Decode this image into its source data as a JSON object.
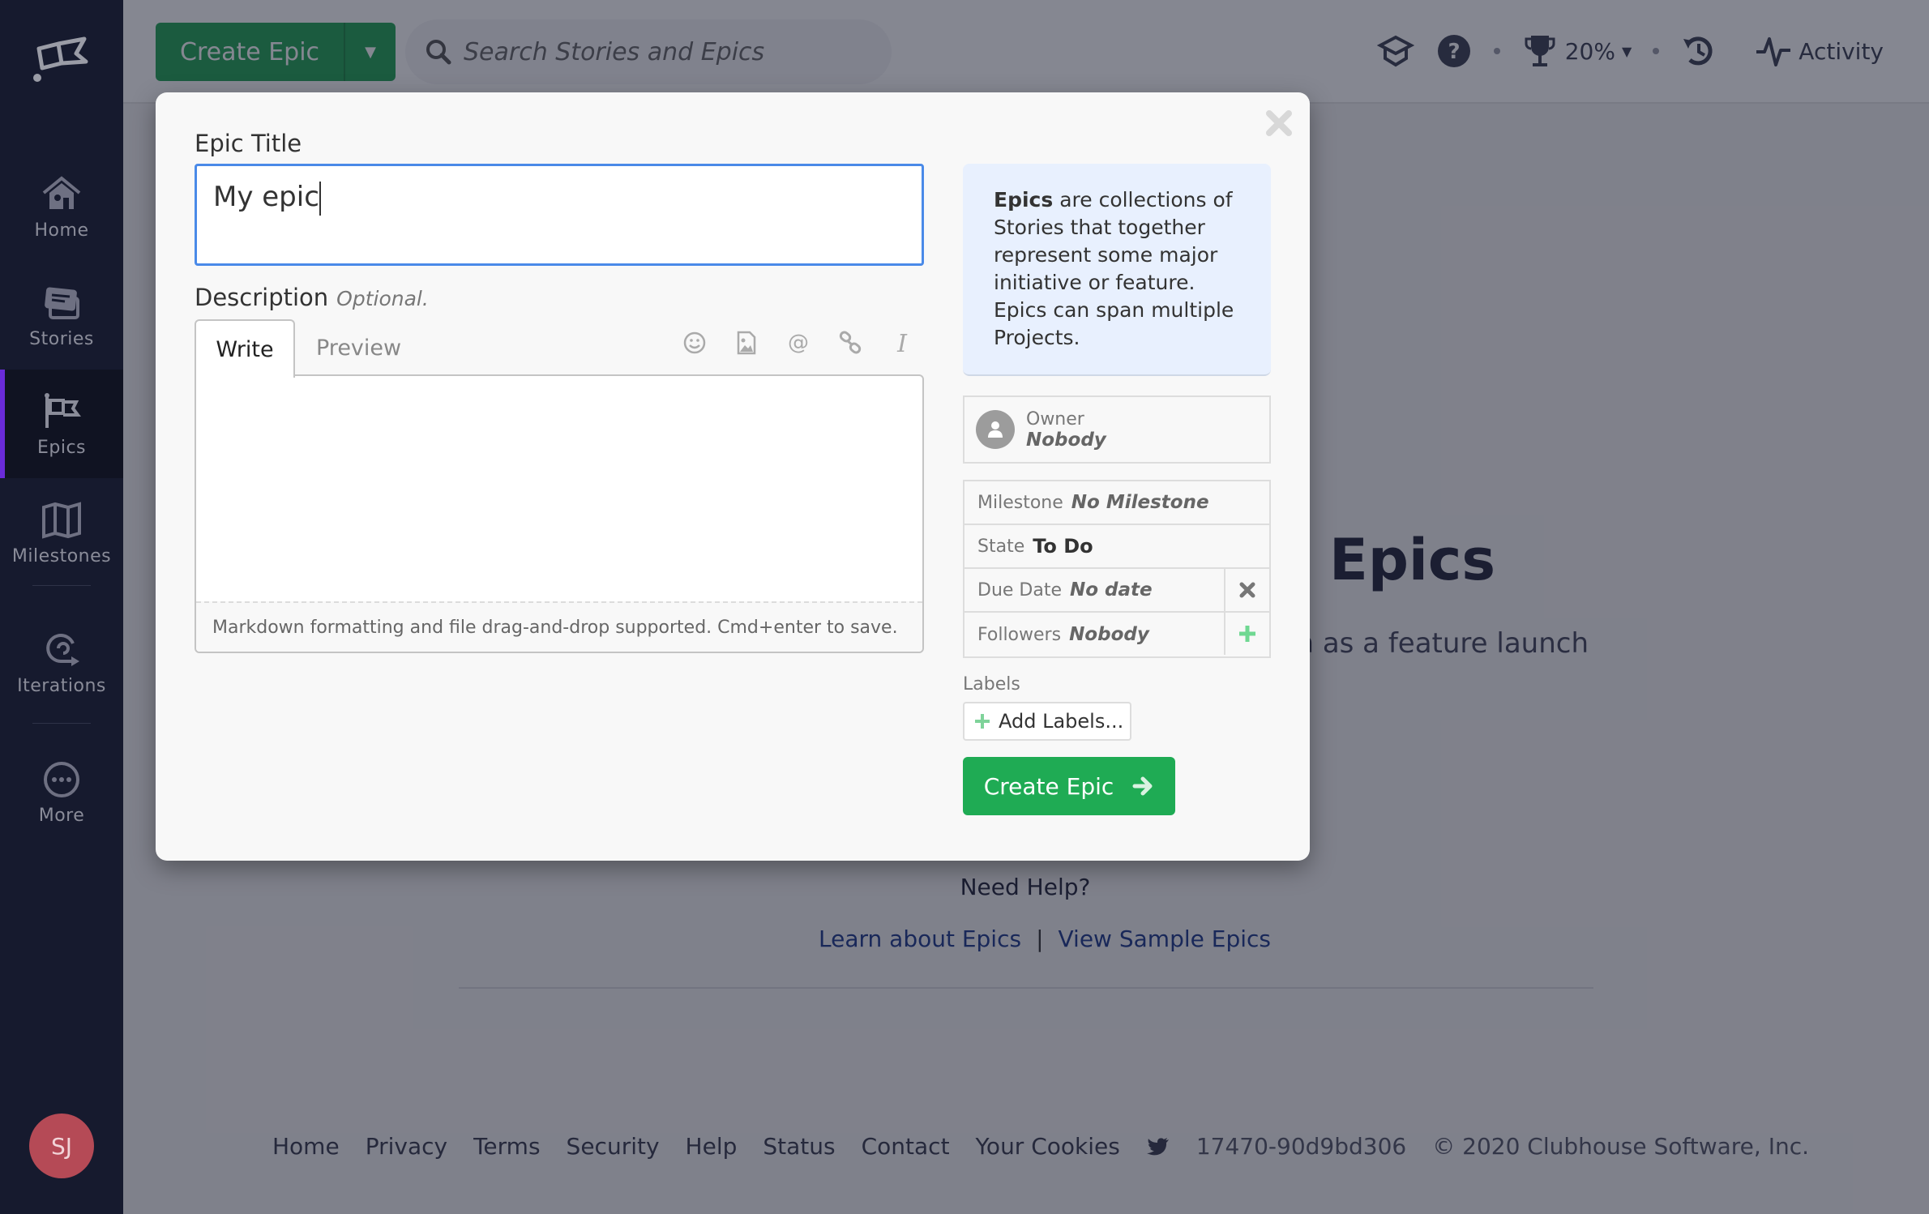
{
  "sidebar": {
    "items": [
      {
        "label": "Home",
        "icon": "home-icon"
      },
      {
        "label": "Stories",
        "icon": "stories-icon"
      },
      {
        "label": "Epics",
        "icon": "epics-flag-icon",
        "active": true
      },
      {
        "label": "Milestones",
        "icon": "map-icon"
      },
      {
        "label": "Iterations",
        "icon": "iterations-icon"
      },
      {
        "label": "More",
        "icon": "more-dots-icon"
      }
    ],
    "avatar_initials": "SJ"
  },
  "topbar": {
    "create_label": "Create Epic",
    "search_placeholder": "Search Stories and Epics",
    "progress_label": "20%",
    "activity_label": "Activity"
  },
  "page": {
    "title": "Epics",
    "subtitle_fragment": "ch as a feature launch",
    "need_help": "Need Help?",
    "links": [
      "Learn about Epics",
      "View Sample Epics"
    ],
    "link_separator": "|"
  },
  "footer": {
    "links": [
      "Home",
      "Privacy",
      "Terms",
      "Security",
      "Help",
      "Status",
      "Contact",
      "Your Cookies"
    ],
    "build": "17470-90d9bd306",
    "copyright": "© 2020 Clubhouse Software, Inc."
  },
  "modal": {
    "title_label": "Epic Title",
    "title_value": "My epic",
    "description_label": "Description",
    "description_optional": "Optional.",
    "tabs": [
      "Write",
      "Preview"
    ],
    "editor_hint": "Markdown formatting and file drag-and-drop supported. Cmd+enter to save.",
    "info_bold": "Epics",
    "info_text": " are collections of Stories that together represent some major initiative or feature. Epics can span multiple Projects.",
    "owner_label": "Owner",
    "owner_value": "Nobody",
    "fields": [
      {
        "label": "Milestone",
        "value": "No Milestone"
      },
      {
        "label": "State",
        "value": "To Do"
      },
      {
        "label": "Due Date",
        "value": "No date"
      },
      {
        "label": "Followers",
        "value": "Nobody"
      }
    ],
    "labels_label": "Labels",
    "add_labels": "Add Labels...",
    "submit_label": "Create Epic"
  },
  "colors": {
    "accent_green": "#1fab54",
    "focus_blue": "#4a8ae8",
    "sidebar_bg": "#161a2e",
    "active_indicator": "#6a2bd9"
  }
}
